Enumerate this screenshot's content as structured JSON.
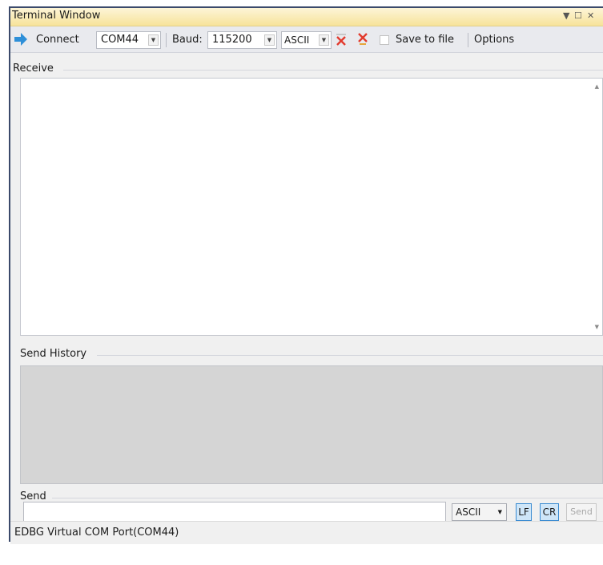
{
  "window": {
    "title": "Terminal Window"
  },
  "toolbar": {
    "connect_label": "Connect",
    "port_value": "COM44",
    "baud_label": "Baud:",
    "baud_value": "115200",
    "mode_value": "ASCII",
    "save_label": "Save to file",
    "options_label": "Options"
  },
  "receive": {
    "label": "Receive",
    "content": ""
  },
  "history": {
    "label": "Send History"
  },
  "send": {
    "label": "Send",
    "input_value": "",
    "mode_value": "ASCII",
    "lf_label": "LF",
    "cr_label": "CR",
    "send_label": "Send"
  },
  "status": {
    "text": "EDBG Virtual COM Port(COM44)"
  },
  "colors": {
    "title_bar": "#f7e39a",
    "accent": "#2e8fd8",
    "history_bg": "#d5d5d5",
    "clear_icon": "#e23b2e"
  }
}
